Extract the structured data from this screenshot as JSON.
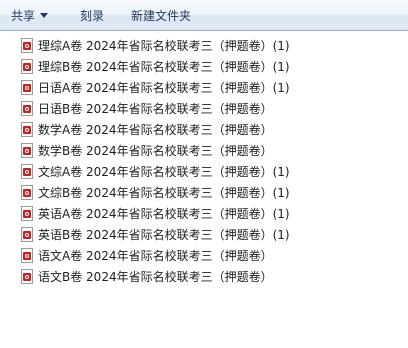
{
  "toolbar": {
    "share_label": "共享",
    "burn_label": "刻录",
    "new_folder_label": "新建文件夹"
  },
  "files": [
    {
      "name": "理综A卷 2024年省际名校联考三（押题卷）(1)",
      "icon": "pdf-icon"
    },
    {
      "name": "理综B卷 2024年省际名校联考三（押题卷）(1)",
      "icon": "pdf-icon"
    },
    {
      "name": "日语A卷 2024年省际名校联考三（押题卷）(1)",
      "icon": "pdf-icon"
    },
    {
      "name": "日语B卷 2024年省际名校联考三（押题卷）",
      "icon": "pdf-icon"
    },
    {
      "name": "数学A卷 2024年省际名校联考三（押题卷）",
      "icon": "pdf-icon"
    },
    {
      "name": "数学B卷 2024年省际名校联考三（押题卷）",
      "icon": "pdf-icon"
    },
    {
      "name": "文综A卷 2024年省际名校联考三（押题卷）(1)",
      "icon": "pdf-icon"
    },
    {
      "name": "文综B卷 2024年省际名校联考三（押题卷）(1)",
      "icon": "pdf-icon"
    },
    {
      "name": "英语A卷 2024年省际名校联考三（押题卷）(1)",
      "icon": "pdf-icon"
    },
    {
      "name": "英语B卷 2024年省际名校联考三（押题卷）(1)",
      "icon": "pdf-icon"
    },
    {
      "name": "语文A卷 2024年省际名校联考三（押题卷）",
      "icon": "pdf-icon"
    },
    {
      "name": "语文B卷 2024年省际名校联考三（押题卷）",
      "icon": "pdf-icon"
    }
  ]
}
